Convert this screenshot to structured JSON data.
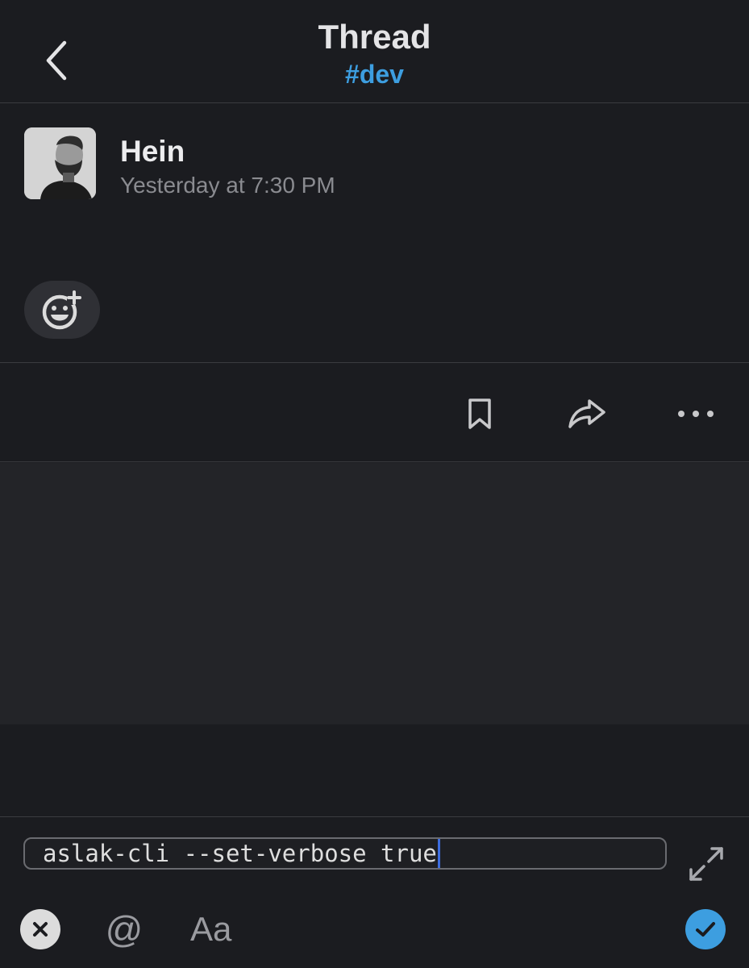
{
  "header": {
    "title": "Thread",
    "channel": "#dev",
    "back_icon": "chevron-left-icon",
    "channel_color": "#3d9ee0"
  },
  "message": {
    "author": "Hein",
    "timestamp": "Yesterday at 7:30 PM",
    "avatar": "avatar",
    "reaction_icon": "add-reaction-icon"
  },
  "actions": {
    "items": [
      {
        "icon": "bookmark-icon"
      },
      {
        "icon": "share-icon"
      },
      {
        "icon": "more-icon"
      }
    ]
  },
  "composer": {
    "input_value": "aslak-cli --set-verbose true",
    "expand_icon": "expand-icon",
    "close_icon": "close-icon",
    "mention_label": "@",
    "format_label": "Aa",
    "send_icon": "checkmark-icon",
    "send_color": "#3d9ee0"
  }
}
